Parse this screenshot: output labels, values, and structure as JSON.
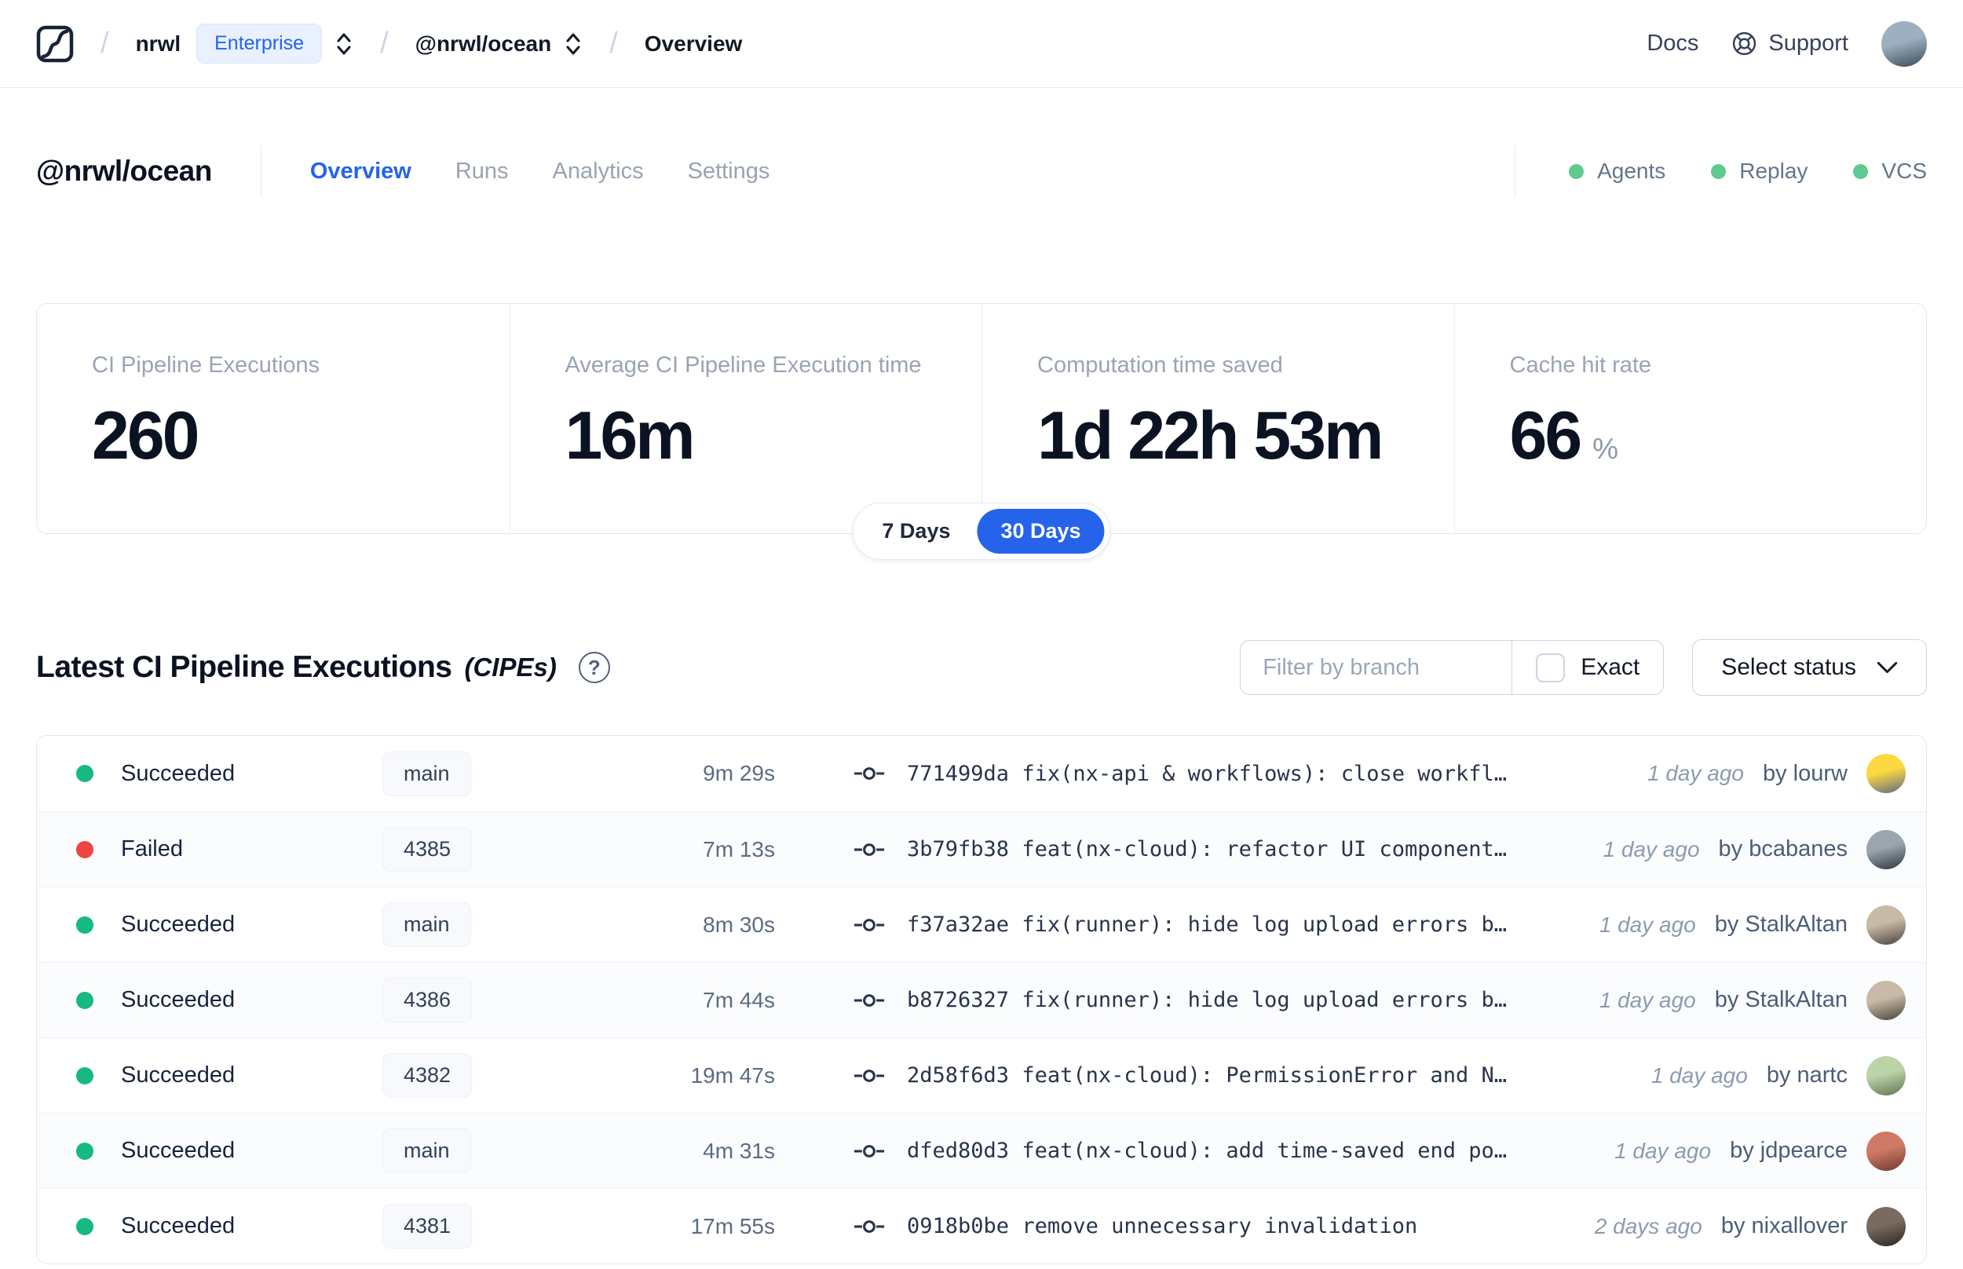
{
  "colors": {
    "accent": "#2563eb",
    "success": "#16b981",
    "failure": "#ee4444",
    "indicator_green": "#5fc98f",
    "topbar_avatar": [
      "#9db0c2",
      "#3c4a57"
    ]
  },
  "topbar": {
    "crumbs": {
      "org": "nrwl",
      "org_badge": "Enterprise",
      "workspace": "@nrwl/ocean",
      "page": "Overview"
    },
    "docs_label": "Docs",
    "support_label": "Support"
  },
  "header": {
    "title": "@nrwl/ocean",
    "tabs": [
      {
        "label": "Overview",
        "active": true
      },
      {
        "label": "Runs",
        "active": false
      },
      {
        "label": "Analytics",
        "active": false
      },
      {
        "label": "Settings",
        "active": false
      }
    ],
    "indicators": [
      {
        "label": "Agents"
      },
      {
        "label": "Replay"
      },
      {
        "label": "VCS"
      }
    ]
  },
  "stats": {
    "cards": [
      {
        "label": "CI Pipeline Executions",
        "value": "260"
      },
      {
        "label": "Average CI Pipeline Execution time",
        "value": "16m"
      },
      {
        "label": "Computation time saved",
        "value": "1d 22h 53m"
      },
      {
        "label": "Cache hit rate",
        "value": "66",
        "suffix": "%"
      }
    ]
  },
  "range_toggle": {
    "options": [
      "7 Days",
      "30 Days"
    ],
    "selected": "30 Days"
  },
  "cipe": {
    "title": "Latest CI Pipeline Executions",
    "title_suffix": "(CIPEs)",
    "help_glyph": "?",
    "filter_placeholder": "Filter by branch",
    "exact_label": "Exact",
    "select_status_label": "Select status",
    "rows": [
      {
        "status": "Succeeded",
        "dot": "#16b981",
        "branch": "main",
        "duration": "9m 29s",
        "commit_hash": "771499da",
        "commit_msg": "fix(nx-api & workflows): close workfl…",
        "time": "1 day ago",
        "author": "by lourw",
        "avatar_colors": [
          "#fcd840",
          "#5a6a85"
        ]
      },
      {
        "status": "Failed",
        "dot": "#ee4444",
        "branch": "4385",
        "duration": "7m 13s",
        "commit_hash": "3b79fb38",
        "commit_msg": "feat(nx-cloud): refactor UI component…",
        "time": "1 day ago",
        "author": "by bcabanes",
        "avatar_colors": [
          "#9aa5ad",
          "#2f353c"
        ]
      },
      {
        "status": "Succeeded",
        "dot": "#16b981",
        "branch": "main",
        "duration": "8m 30s",
        "commit_hash": "f37a32ae",
        "commit_msg": "fix(runner): hide log upload errors b…",
        "time": "1 day ago",
        "author": "by StalkAltan",
        "avatar_colors": [
          "#c8baa6",
          "#4a423b"
        ]
      },
      {
        "status": "Succeeded",
        "dot": "#16b981",
        "branch": "4386",
        "duration": "7m 44s",
        "commit_hash": "b8726327",
        "commit_msg": "fix(runner): hide log upload errors b…",
        "time": "1 day ago",
        "author": "by StalkAltan",
        "avatar_colors": [
          "#c8baa6",
          "#4a423b"
        ]
      },
      {
        "status": "Succeeded",
        "dot": "#16b981",
        "branch": "4382",
        "duration": "19m 47s",
        "commit_hash": "2d58f6d3",
        "commit_msg": "feat(nx-cloud): PermissionError and N…",
        "time": "1 day ago",
        "author": "by nartc",
        "avatar_colors": [
          "#bcd3a8",
          "#5f7355"
        ]
      },
      {
        "status": "Succeeded",
        "dot": "#16b981",
        "branch": "main",
        "duration": "4m 31s",
        "commit_hash": "dfed80d3",
        "commit_msg": "feat(nx-cloud): add time-saved end po…",
        "time": "1 day ago",
        "author": "by jdpearce",
        "avatar_colors": [
          "#cf7a64",
          "#6e3a31"
        ]
      },
      {
        "status": "Succeeded",
        "dot": "#16b981",
        "branch": "4381",
        "duration": "17m 55s",
        "commit_hash": "0918b0be",
        "commit_msg": "remove unnecessary invalidation",
        "time": "2 days ago",
        "author": "by nixallover",
        "avatar_colors": [
          "#7a6a60",
          "#2b2622"
        ]
      }
    ]
  }
}
